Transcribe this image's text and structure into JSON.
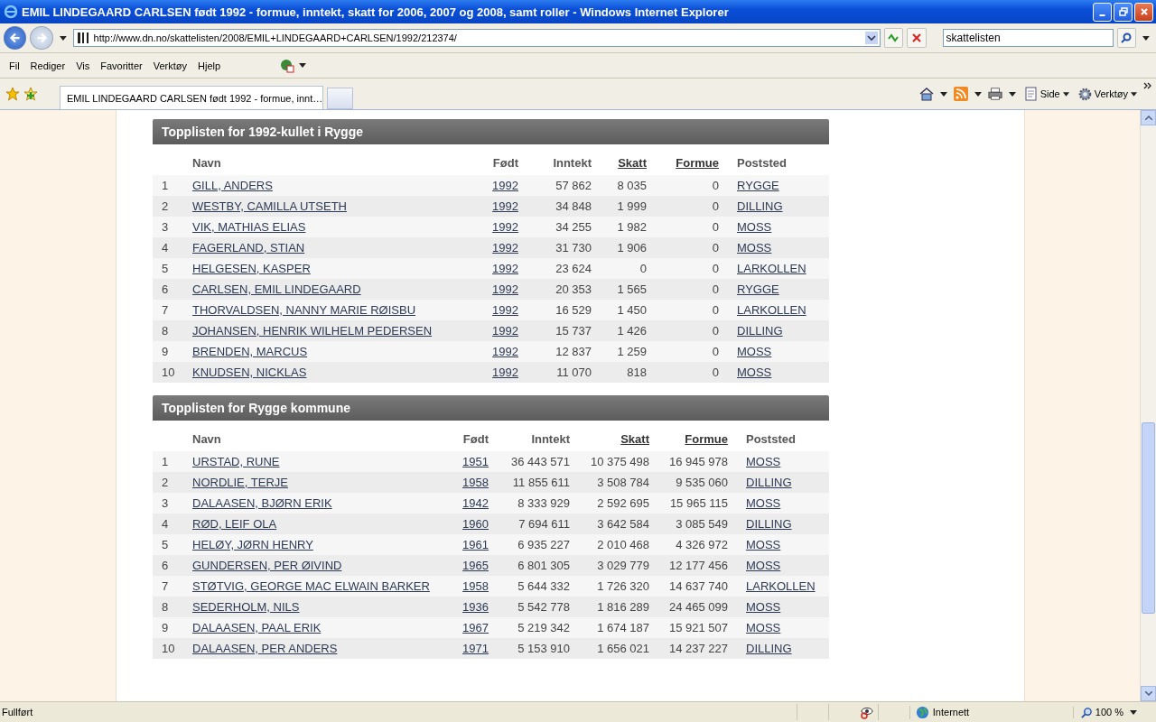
{
  "window": {
    "title": "EMIL LINDEGAARD CARLSEN født 1992 - formue, inntekt, skatt for 2006, 2007 og 2008, samt roller  - Windows Internet Explorer"
  },
  "address_bar": {
    "url": "http://www.dn.no/skattelisten/2008/EMIL+LINDEGAARD+CARLSEN/1992/212374/"
  },
  "search": {
    "value": "skattelisten"
  },
  "menu": [
    "Fil",
    "Rediger",
    "Vis",
    "Favoritter",
    "Verktøy",
    "Hjelp"
  ],
  "tabs": [
    {
      "label": "EMIL LINDEGAARD CARLSEN født 1992 - formue, innt…",
      "selected": true
    }
  ],
  "command_bar": {
    "page": "Side",
    "tools": "Verktøy"
  },
  "tables": [
    {
      "title": "Topplisten for 1992-kullet i Rygge",
      "columns": [
        {
          "label": "Navn",
          "sortable": false
        },
        {
          "label": "Født",
          "sortable": false
        },
        {
          "label": "Inntekt",
          "sortable": false
        },
        {
          "label": "Skatt",
          "sortable": true
        },
        {
          "label": "Formue",
          "sortable": true
        },
        {
          "label": "Poststed",
          "sortable": false
        }
      ],
      "rows": [
        {
          "rank": "1",
          "cells": [
            "GILL, ANDERS",
            "1992",
            "57 862",
            "8 035",
            "0",
            "RYGGE"
          ]
        },
        {
          "rank": "2",
          "cells": [
            "WESTBY, CAMILLA UTSETH",
            "1992",
            "34 848",
            "1 999",
            "0",
            "DILLING"
          ]
        },
        {
          "rank": "3",
          "cells": [
            "VIK, MATHIAS ELIAS",
            "1992",
            "34 255",
            "1 982",
            "0",
            "MOSS"
          ]
        },
        {
          "rank": "4",
          "cells": [
            "FAGERLAND, STIAN",
            "1992",
            "31 730",
            "1 906",
            "0",
            "MOSS"
          ]
        },
        {
          "rank": "5",
          "cells": [
            "HELGESEN, KASPER",
            "1992",
            "23 624",
            "0",
            "0",
            "LARKOLLEN"
          ]
        },
        {
          "rank": "6",
          "cells": [
            "CARLSEN, EMIL LINDEGAARD",
            "1992",
            "20 353",
            "1 565",
            "0",
            "RYGGE"
          ]
        },
        {
          "rank": "7",
          "cells": [
            "THORVALDSEN, NANNY MARIE RØISBU",
            "1992",
            "16 529",
            "1 450",
            "0",
            "LARKOLLEN"
          ]
        },
        {
          "rank": "8",
          "cells": [
            "JOHANSEN, HENRIK WILHELM PEDERSEN",
            "1992",
            "15 737",
            "1 426",
            "0",
            "DILLING"
          ]
        },
        {
          "rank": "9",
          "cells": [
            "BRENDEN, MARCUS",
            "1992",
            "12 837",
            "1 259",
            "0",
            "MOSS"
          ]
        },
        {
          "rank": "10",
          "cells": [
            "KNUDSEN, NICKLAS",
            "1992",
            "11 070",
            "818",
            "0",
            "MOSS"
          ]
        }
      ]
    },
    {
      "title": "Topplisten for Rygge kommune",
      "columns": [
        {
          "label": "Navn",
          "sortable": false
        },
        {
          "label": "Født",
          "sortable": false
        },
        {
          "label": "Inntekt",
          "sortable": false
        },
        {
          "label": "Skatt",
          "sortable": true
        },
        {
          "label": "Formue",
          "sortable": true
        },
        {
          "label": "Poststed",
          "sortable": false
        }
      ],
      "rows": [
        {
          "rank": "1",
          "cells": [
            "URSTAD, RUNE",
            "1951",
            "36 443 571",
            "10 375 498",
            "16 945 978",
            "MOSS"
          ]
        },
        {
          "rank": "2",
          "cells": [
            "NORDLIE, TERJE",
            "1958",
            "11 855 611",
            "3 508 784",
            "9 535 060",
            "DILLING"
          ]
        },
        {
          "rank": "3",
          "cells": [
            "DALAASEN, BJØRN ERIK",
            "1942",
            "8 333 929",
            "2 592 695",
            "15 965 115",
            "MOSS"
          ]
        },
        {
          "rank": "4",
          "cells": [
            "RØD, LEIF OLA",
            "1960",
            "7 694 611",
            "3 642 584",
            "3 085 549",
            "DILLING"
          ]
        },
        {
          "rank": "5",
          "cells": [
            "HELØY, JØRN HENRY",
            "1961",
            "6 935 227",
            "2 010 468",
            "4 326 972",
            "MOSS"
          ]
        },
        {
          "rank": "6",
          "cells": [
            "GUNDERSEN, PER ØIVIND",
            "1965",
            "6 801 305",
            "3 029 779",
            "12 177 456",
            "MOSS"
          ]
        },
        {
          "rank": "7",
          "cells": [
            "STØTVIG, GEORGE MAC ELWAIN BARKER",
            "1958",
            "5 644 332",
            "1 726 320",
            "14 637 740",
            "LARKOLLEN"
          ]
        },
        {
          "rank": "8",
          "cells": [
            "SEDERHOLM, NILS",
            "1936",
            "5 542 778",
            "1 816 289",
            "24 465 099",
            "MOSS"
          ]
        },
        {
          "rank": "9",
          "cells": [
            "DALAASEN, PAAL ERIK",
            "1967",
            "5 219 342",
            "1 674 187",
            "15 921 507",
            "MOSS"
          ]
        },
        {
          "rank": "10",
          "cells": [
            "DALAASEN, PER ANDERS",
            "1971",
            "5 153 910",
            "1 656 021",
            "14 237 227",
            "DILLING"
          ]
        }
      ]
    }
  ],
  "status_bar": {
    "text": "Fullført",
    "zone": "Internett",
    "zoom": "100 %"
  }
}
